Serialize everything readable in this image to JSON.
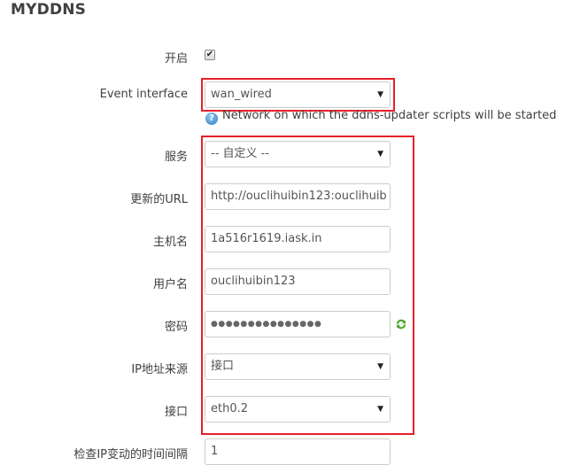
{
  "section": {
    "title": "MYDDNS"
  },
  "fields": {
    "enable": {
      "label": "开启",
      "checked": true,
      "check_glyph": "✔"
    },
    "event_interface": {
      "label": "Event interface",
      "value": "wan_wired",
      "hint": "Network on which the ddns-updater scripts will be started",
      "hint_icon": "help-icon"
    },
    "service": {
      "label": "服务",
      "value": "-- 自定义 --"
    },
    "update_url": {
      "label": "更新的URL",
      "value": "http://ouclihuibin123:ouclihuib"
    },
    "hostname": {
      "label": "主机名",
      "value": "1a516r1619.iask.in"
    },
    "username": {
      "label": "用户名",
      "value": "ouclihuibin123"
    },
    "password": {
      "label": "密码",
      "value": "●●●●●●●●●●●●●●●",
      "reveal_icon": "refresh-icon"
    },
    "ip_source": {
      "label": "IP地址来源",
      "value": "接口"
    },
    "interface": {
      "label": "接口",
      "value": "eth0.2"
    },
    "check_interval": {
      "label": "检查IP变动的时间间隔",
      "value": "1"
    }
  },
  "ui": {
    "dropdown_arrow": "▼",
    "highlight_color": "#e8202a",
    "help_icon_glyph": "?"
  }
}
